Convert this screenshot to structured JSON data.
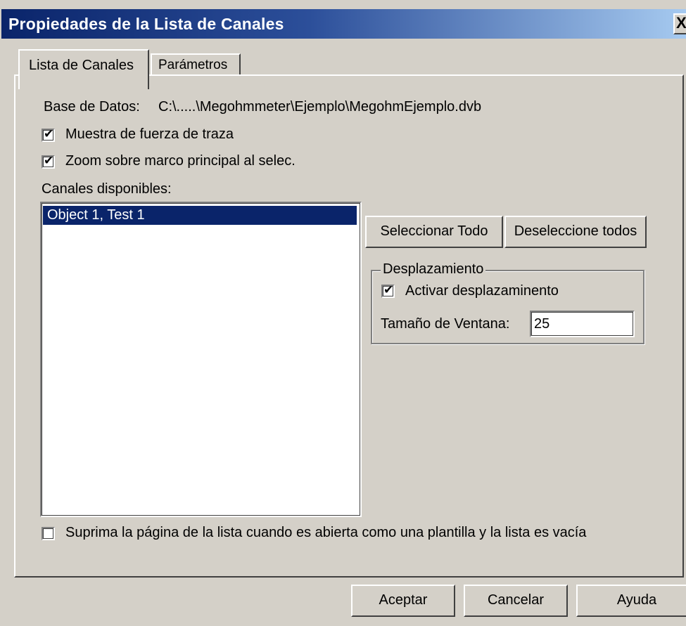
{
  "window": {
    "title": "Propiedades de la Lista de Canales",
    "close_glyph": "X"
  },
  "tabs": [
    {
      "label": "Lista de Canales",
      "active": true
    },
    {
      "label": "Parámetros",
      "active": false
    }
  ],
  "database": {
    "label": "Base de Datos:",
    "path": "C:\\.....\\Megohmmeter\\Ejemplo\\MegohmEjemplo.dvb"
  },
  "options": {
    "show_trace_strength": {
      "label": "Muestra de fuerza de traza",
      "checked": true
    },
    "zoom_on_select": {
      "label": "Zoom sobre marco principal al selec.",
      "checked": true
    }
  },
  "channels": {
    "label": "Canales disponibles:",
    "items": [
      {
        "label": "Object 1, Test 1",
        "selected": true
      }
    ]
  },
  "selection_buttons": {
    "select_all": "Seleccionar Todo",
    "deselect_all": "Deseleccione todos"
  },
  "scroll_group": {
    "title": "Desplazamiento",
    "enable": {
      "label": "Activar desplazaminento",
      "checked": true
    },
    "window_size_label": "Tamaño de Ventana:",
    "window_size_value": "25"
  },
  "suppress_page": {
    "label": "Suprima la página de la lista cuando es abierta como una plantilla y la lista es vacía",
    "checked": false
  },
  "footer_buttons": {
    "accept": "Aceptar",
    "cancel": "Cancelar",
    "help": "Ayuda"
  },
  "colors": {
    "title_gradient_start": "#0a246a",
    "title_gradient_end": "#a6caf0",
    "face": "#d4d0c8",
    "selection": "#0a246a"
  }
}
